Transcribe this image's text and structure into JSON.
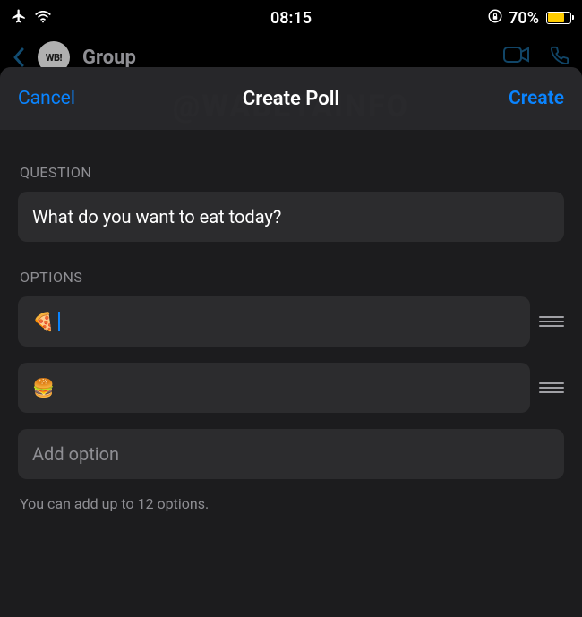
{
  "status": {
    "time": "08:15",
    "battery_pct": "70%"
  },
  "chat": {
    "title": "Group"
  },
  "watermark": "@WABETAINFO",
  "modal": {
    "cancel": "Cancel",
    "create": "Create",
    "title": "Create Poll",
    "question_label": "QUESTION",
    "question_value": "What do you want to eat today?",
    "options_label": "OPTIONS",
    "options": [
      {
        "value": "🍕"
      },
      {
        "value": "🍔"
      }
    ],
    "add_option_placeholder": "Add option",
    "hint": "You can add up to 12 options."
  },
  "colors": {
    "accent": "#0a84ff",
    "bg": "#1c1c1e",
    "field": "#2c2c2e",
    "muted": "#8e8e93"
  }
}
